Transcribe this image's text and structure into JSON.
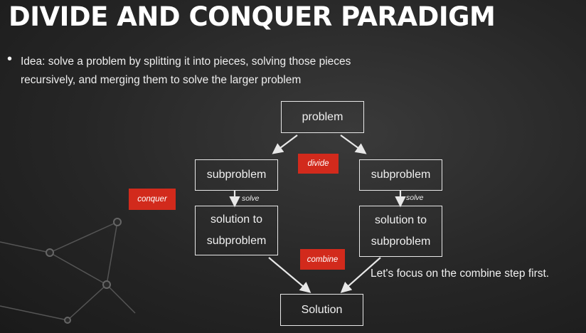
{
  "title": "DIVIDE AND CONQUER PARADIGM",
  "bullet": "Idea: solve a problem by splitting it into pieces, solving those pieces recursively, and merging them to solve the larger problem",
  "diagram": {
    "problem": "problem",
    "subproblem_left": "subproblem",
    "subproblem_right": "subproblem",
    "solution_left": "solution to subproblem",
    "solution_right": "solution to subproblem",
    "solution": "Solution",
    "divide_tag": "divide",
    "conquer_tag": "conquer",
    "combine_tag": "combine",
    "solve_left": "solve",
    "solve_right": "solve"
  },
  "note": "Let's focus on the combine step first.",
  "colors": {
    "tag": "#d22a1c",
    "background": "#2a2a2a",
    "line": "#e8e8e8"
  }
}
